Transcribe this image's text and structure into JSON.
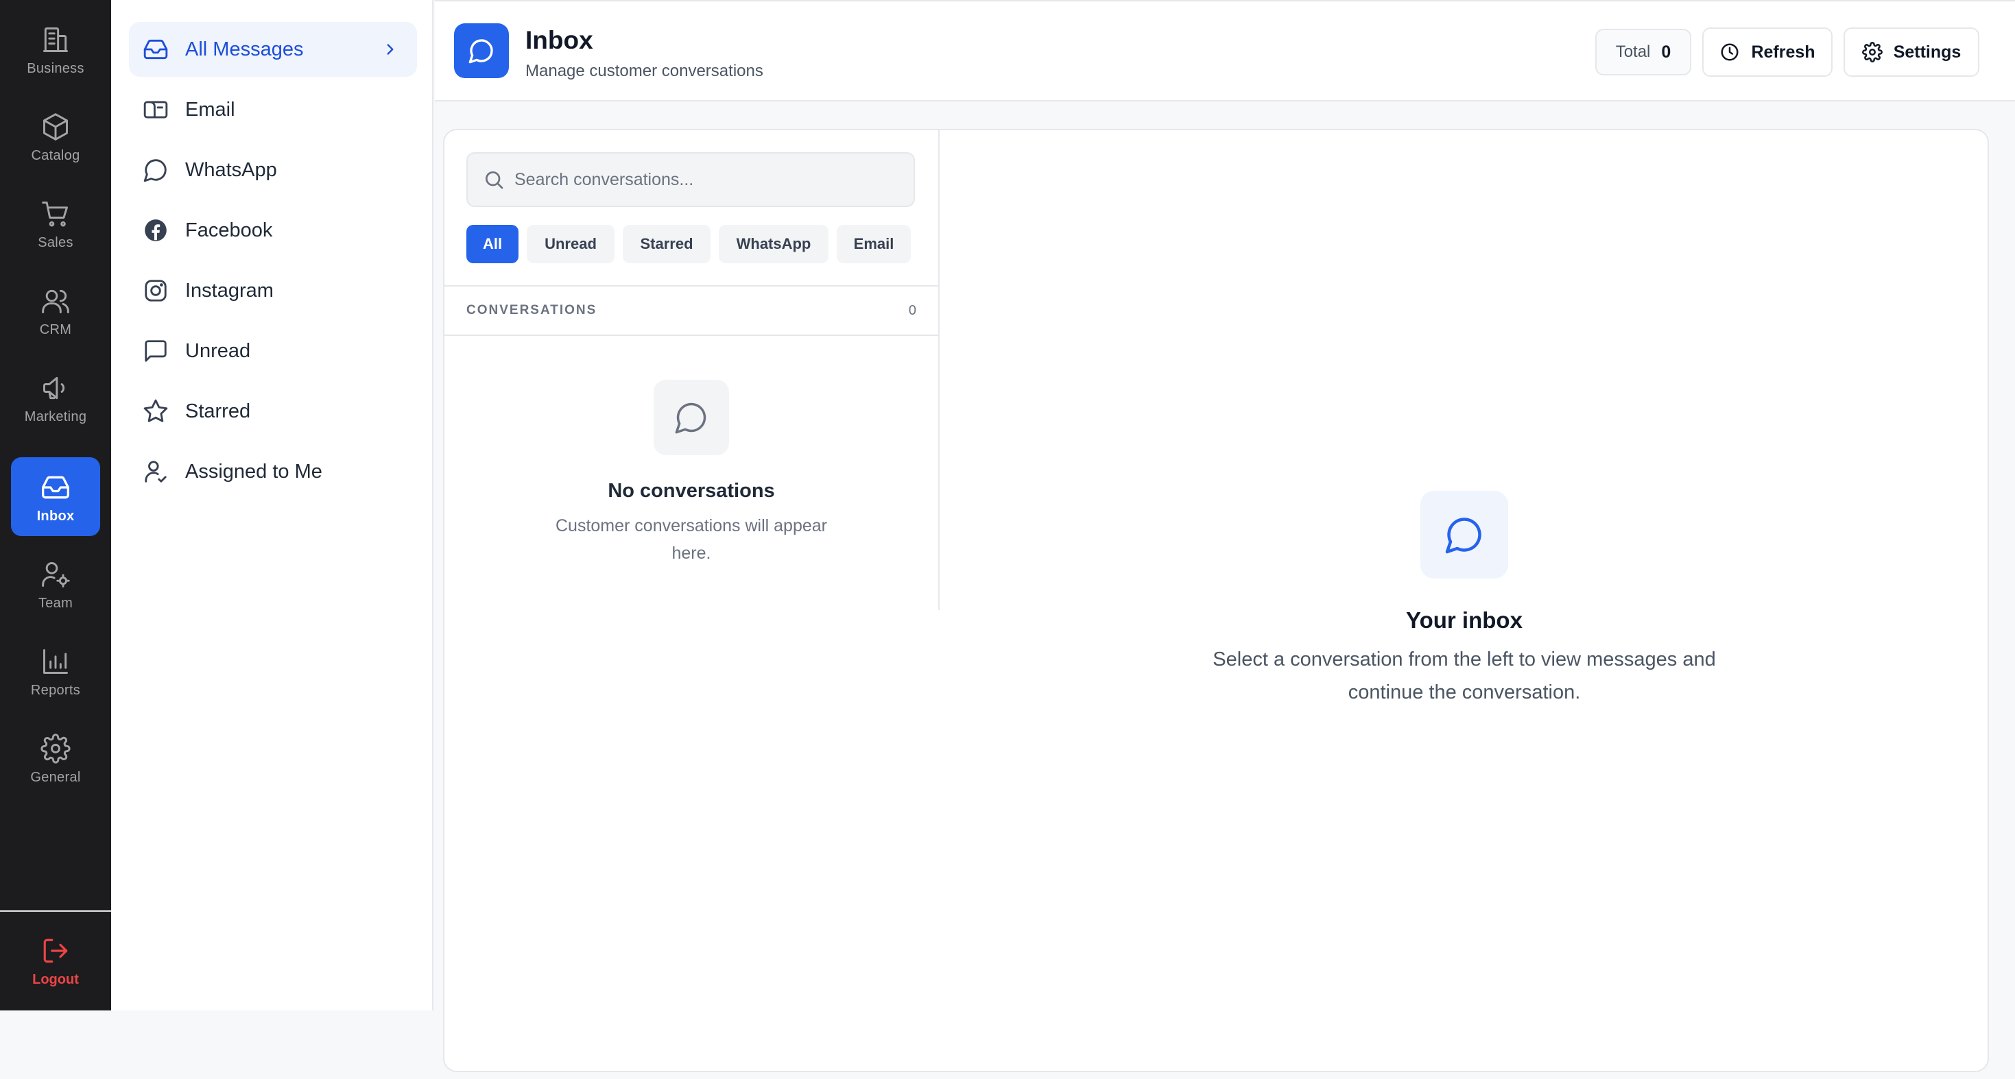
{
  "rail": {
    "items": [
      {
        "label": "Business",
        "icon": "building-icon"
      },
      {
        "label": "Catalog",
        "icon": "box-icon"
      },
      {
        "label": "Sales",
        "icon": "cart-icon"
      },
      {
        "label": "CRM",
        "icon": "users-icon"
      },
      {
        "label": "Marketing",
        "icon": "megaphone-icon"
      },
      {
        "label": "Inbox",
        "icon": "inbox-icon",
        "active": true
      },
      {
        "label": "Team",
        "icon": "user-cog-icon"
      },
      {
        "label": "Reports",
        "icon": "bar-chart-icon"
      },
      {
        "label": "General",
        "icon": "gear-icon"
      }
    ],
    "logout_label": "Logout"
  },
  "subnav": {
    "items": [
      {
        "label": "All Messages",
        "icon": "inbox-icon",
        "active": true
      },
      {
        "label": "Email",
        "icon": "mailbox-icon"
      },
      {
        "label": "WhatsApp",
        "icon": "chat-bubble-icon"
      },
      {
        "label": "Facebook",
        "icon": "facebook-icon"
      },
      {
        "label": "Instagram",
        "icon": "instagram-icon"
      },
      {
        "label": "Unread",
        "icon": "message-square-icon"
      },
      {
        "label": "Starred",
        "icon": "star-icon"
      },
      {
        "label": "Assigned to Me",
        "icon": "user-icon"
      }
    ]
  },
  "header": {
    "title": "Inbox",
    "subtitle": "Manage customer conversations",
    "total_label": "Total",
    "total_value": "0",
    "refresh_label": "Refresh",
    "settings_label": "Settings"
  },
  "list": {
    "search_placeholder": "Search conversations...",
    "filters": [
      "All",
      "Unread",
      "Starred",
      "WhatsApp",
      "Email"
    ],
    "active_filter": "All",
    "section_title": "CONVERSATIONS",
    "count": "0",
    "empty_title": "No conversations",
    "empty_desc": "Customer conversations will appear here."
  },
  "detail": {
    "empty_title": "Your inbox",
    "empty_desc": "Select a conversation from the left to view messages and continue the conversation."
  },
  "colors": {
    "accent": "#2563eb",
    "rail_bg": "#1c1c1e",
    "logout": "#ef4444",
    "active_sub_bg": "#eff4fd"
  }
}
